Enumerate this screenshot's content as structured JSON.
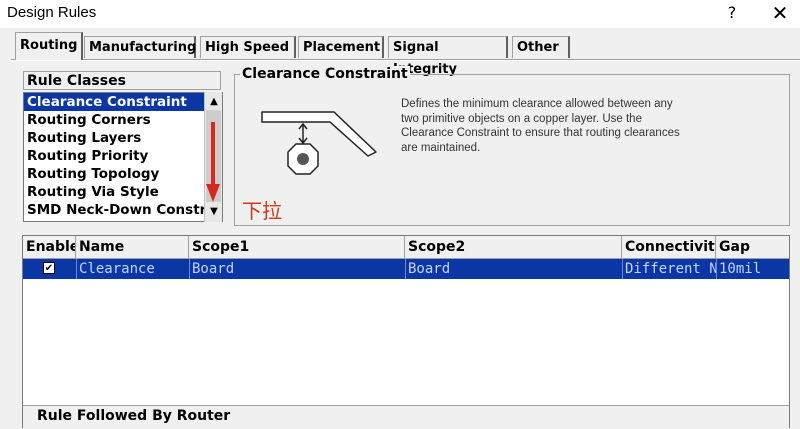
{
  "window": {
    "title": "Design Rules",
    "help_glyph": "?",
    "close_glyph": "✕"
  },
  "tabs": [
    {
      "label": "Routing",
      "active": true
    },
    {
      "label": "Manufacturing",
      "active": false
    },
    {
      "label": "High Speed",
      "active": false
    },
    {
      "label": "Placement",
      "active": false
    },
    {
      "label": "Signal Integrity",
      "active": false
    },
    {
      "label": "Other",
      "active": false
    }
  ],
  "rule_classes": {
    "label": "Rule Classes",
    "items": [
      "Clearance Constraint",
      "Routing Corners",
      "Routing Layers",
      "Routing Priority",
      "Routing Topology",
      "Routing Via Style",
      "SMD Neck-Down Constraint"
    ],
    "selected_index": 0,
    "scroll_up_glyph": "▲",
    "scroll_down_glyph": "▼"
  },
  "annotation": {
    "text": "下拉",
    "color": "#cc3a1a"
  },
  "constraint": {
    "title": "Clearance Constraint",
    "description": "Defines the minimum clearance allowed between any two primitive objects on a copper layer. Use the Clearance Constraint to ensure that routing clearances are maintained."
  },
  "rules_table": {
    "columns": [
      "Enable",
      "Name",
      "Scope1",
      "Scope2",
      "Connectivity",
      "Gap"
    ],
    "rows": [
      {
        "enabled": true,
        "check_glyph": "✔",
        "name": "Clearance",
        "scope1": "Board",
        "scope2": "Board",
        "connectivity": "Different Net",
        "gap": "10mil"
      }
    ]
  },
  "footer": {
    "label": "Rule Followed By Router"
  },
  "colors": {
    "selection": "#0a36a6",
    "selection_text": "#c6d3ff",
    "window_bg": "#f0f0f0"
  }
}
